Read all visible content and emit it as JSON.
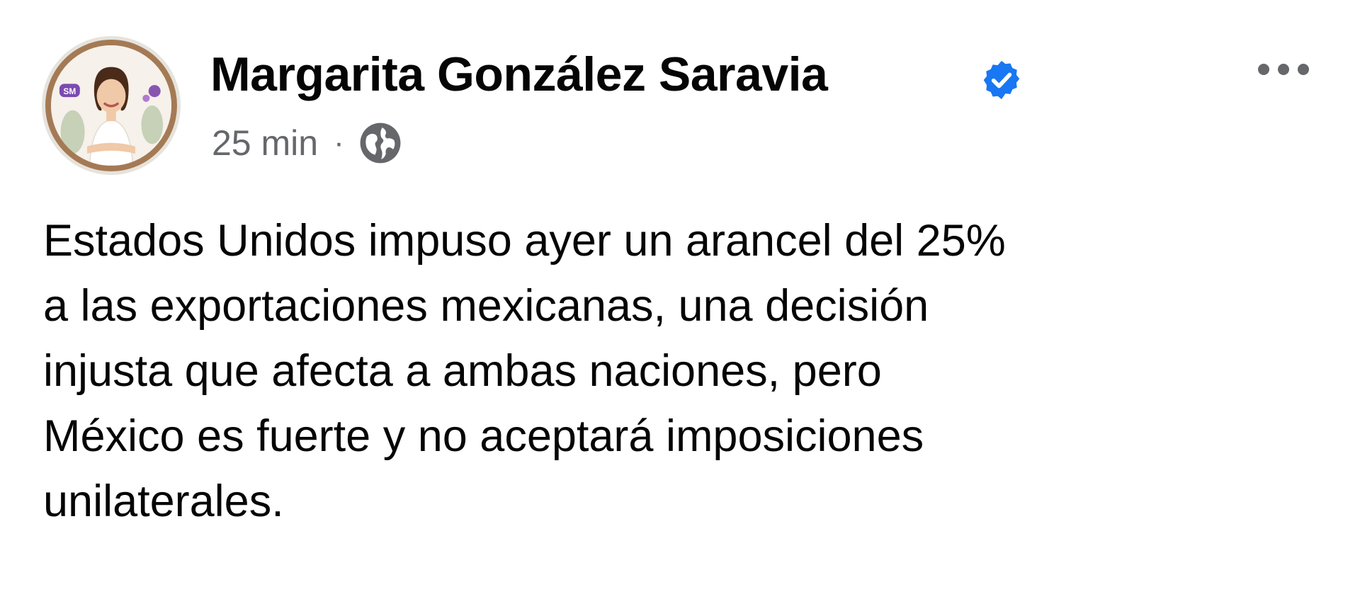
{
  "post": {
    "author": {
      "name": "Margarita González Saravia",
      "avatar_badge": "SM",
      "verified_icon": "verified-badge-icon",
      "verified_color": "#1877f2"
    },
    "meta": {
      "time": "25 min",
      "separator": "·",
      "audience_icon": "globe-icon"
    },
    "more_icon": "more-options-icon",
    "text": "Estados Unidos impuso ayer un arancel del 25%\na las exportaciones mexicanas, una decisión\ninjusta que afecta a ambas naciones, pero\nMéxico es fuerte y no aceptará imposiciones\nunilaterales."
  }
}
